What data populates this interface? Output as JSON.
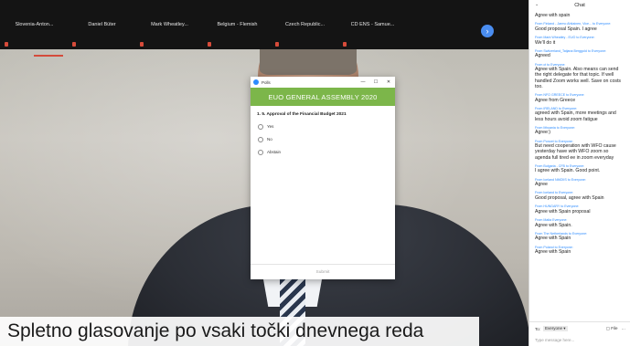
{
  "thumbnails": [
    {
      "name": "Slovenia-Anton..."
    },
    {
      "name": "Daniel Büter"
    },
    {
      "name": "Mark Wheatley..."
    },
    {
      "name": "Belgium - Flemish"
    },
    {
      "name": "Czech Republic..."
    },
    {
      "name": "CD ENS - Samue..."
    }
  ],
  "next_button": "›",
  "poll": {
    "window_title": "Polls",
    "minimize": "—",
    "maximize": "☐",
    "close": "✕",
    "banner": "EUO GENERAL ASSEMBLY 2020",
    "question": "1. 5. Approval of the Financial Budget 2021",
    "options": [
      "Yes",
      "No",
      "Abstain"
    ],
    "submit": "Submit"
  },
  "caption": "Spletno glasovanje po vsaki točki dnevnega reda",
  "chat": {
    "collapse_icon": "⌄",
    "title": "Chat",
    "messages": [
      {
        "from": "",
        "text": "Agree with spain"
      },
      {
        "from": "From Finland - Jarmo Ahtiainen, Vice... to Everyone:",
        "text": "Good proposal Spain. I agree"
      },
      {
        "from": "From Mark Wheatley - EUO to Everyone:",
        "text": "We'll do it"
      },
      {
        "from": "From Switzerland_Tatjana Berggold to Everyone:",
        "text": "Agreed"
      },
      {
        "from": "From ct to Everyone:",
        "text": "Agree with Spain. Also means can send the right delegate for that topic. If well handled Zoom works well. Save on costs too."
      },
      {
        "from": "From NFO GREECE to Everyone:",
        "text": "Agree from Greece"
      },
      {
        "from": "From IRELAND to Everyone:",
        "text": "agreed with Spain, more meetings and less hours avoid zoom fatigue"
      },
      {
        "from": "From lithuania to Everyone:",
        "text": "Agree:)"
      },
      {
        "from": "From Poncet to Everyone:",
        "text": "But need cooperation with WFO cause yesterday have with WFO zoom so agenda full tired ee in zoom everyday"
      },
      {
        "from": "From Bulgaria - CFB to Everyone:",
        "text": "I agree with Spain. Good point."
      },
      {
        "from": "From Iceland NMOIIS to Everyone:",
        "text": "Agree"
      },
      {
        "from": "From Iceland to Everyone:",
        "text": "Good proposal, agree with Spain"
      },
      {
        "from": "From HUNGARY to Everyone:",
        "text": "Agree with Spain proposal"
      },
      {
        "from": "From Malta Everyone:",
        "text": "Agree with Spain."
      },
      {
        "from": "From The Netherlands to Everyone:",
        "text": "Agree with Spain"
      },
      {
        "from": "From Poland to Everyone:",
        "text": "Agree with Spain"
      }
    ],
    "to_label": "To:",
    "recipient": "Everyone ▾",
    "file_label": "▢ File",
    "more_label": "···",
    "input_placeholder": "Type message here..."
  }
}
